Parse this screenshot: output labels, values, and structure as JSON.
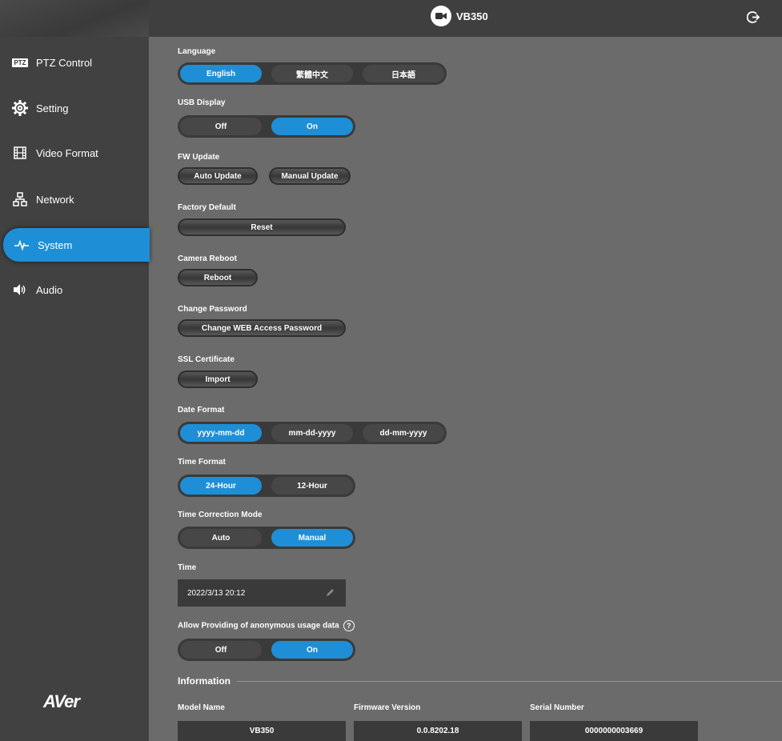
{
  "header": {
    "title": "VB350"
  },
  "sidebar": {
    "brand": "AVer",
    "items": [
      {
        "label": "PTZ Control",
        "icon": "ptz-badge-icon",
        "badge": "PTZ"
      },
      {
        "label": "Setting",
        "icon": "gear-icon"
      },
      {
        "label": "Video Format",
        "icon": "film-icon"
      },
      {
        "label": "Network",
        "icon": "network-icon"
      },
      {
        "label": "System",
        "icon": "pulse-icon",
        "active": true
      },
      {
        "label": "Audio",
        "icon": "speaker-icon"
      }
    ]
  },
  "settings": {
    "language": {
      "label": "Language",
      "options": [
        "English",
        "繁體中文",
        "日本語"
      ],
      "selected": "English"
    },
    "usb_display": {
      "label": "USB Display",
      "options": [
        "Off",
        "On"
      ],
      "selected": "On"
    },
    "fw_update": {
      "label": "FW Update",
      "auto": "Auto Update",
      "manual": "Manual Update"
    },
    "factory_default": {
      "label": "Factory Default",
      "button": "Reset"
    },
    "camera_reboot": {
      "label": "Camera Reboot",
      "button": "Reboot"
    },
    "change_password": {
      "label": "Change Password",
      "button": "Change WEB Access Password"
    },
    "ssl": {
      "label": "SSL Certificate",
      "button": "Import"
    },
    "date_format": {
      "label": "Date Format",
      "options": [
        "yyyy-mm-dd",
        "mm-dd-yyyy",
        "dd-mm-yyyy"
      ],
      "selected": "yyyy-mm-dd"
    },
    "time_format": {
      "label": "Time Format",
      "options": [
        "24-Hour",
        "12-Hour"
      ],
      "selected": "24-Hour"
    },
    "time_correction": {
      "label": "Time Correction Mode",
      "options": [
        "Auto",
        "Manual"
      ],
      "selected": "Manual"
    },
    "time": {
      "label": "Time",
      "value": "2022/3/13 20:12"
    },
    "usage_data": {
      "label": "Allow Providing of anonymous usage data",
      "help": "?",
      "options": [
        "Off",
        "On"
      ],
      "selected": "On"
    }
  },
  "information": {
    "title": "Information",
    "model_name": {
      "label": "Model Name",
      "value": "VB350"
    },
    "firmware_version": {
      "label": "Firmware Version",
      "value": "0.0.8202.18"
    },
    "serial_number": {
      "label": "Serial Number",
      "value": "0000000003669"
    }
  },
  "colors": {
    "accent": "#1e8fd6",
    "sidebar": "#414141",
    "main_bg": "#6b6b6b",
    "control_bg": "#3a3a3a"
  }
}
